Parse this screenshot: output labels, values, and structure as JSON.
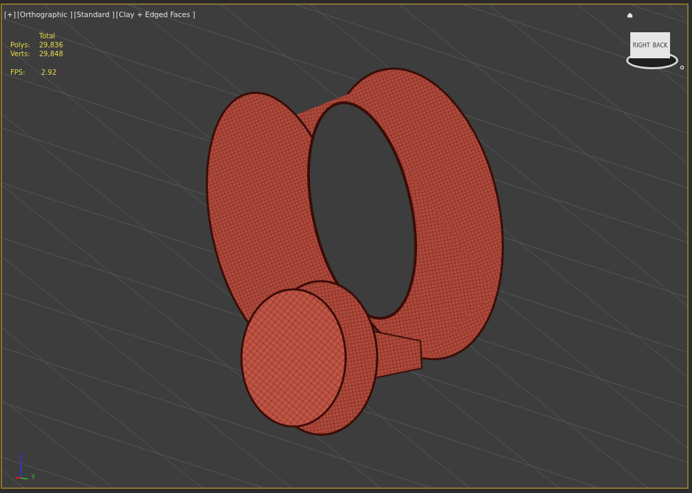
{
  "viewport": {
    "labels": [
      {
        "text": "[+]"
      },
      {
        "text": "[Orthographic ]"
      },
      {
        "text": "[Standard ]"
      },
      {
        "text": "[Clay + Edged Faces ]"
      }
    ],
    "stats": {
      "header": "Total",
      "rows": [
        {
          "label": "Polys:",
          "value": "29,836"
        },
        {
          "label": "Verts:",
          "value": "29,848"
        }
      ],
      "fps_label": "FPS:",
      "fps_value": "2.92"
    },
    "viewcube": {
      "faces": [
        "RIGHT",
        "BACK"
      ]
    },
    "axis_labels": [
      "Z",
      "Y"
    ]
  }
}
